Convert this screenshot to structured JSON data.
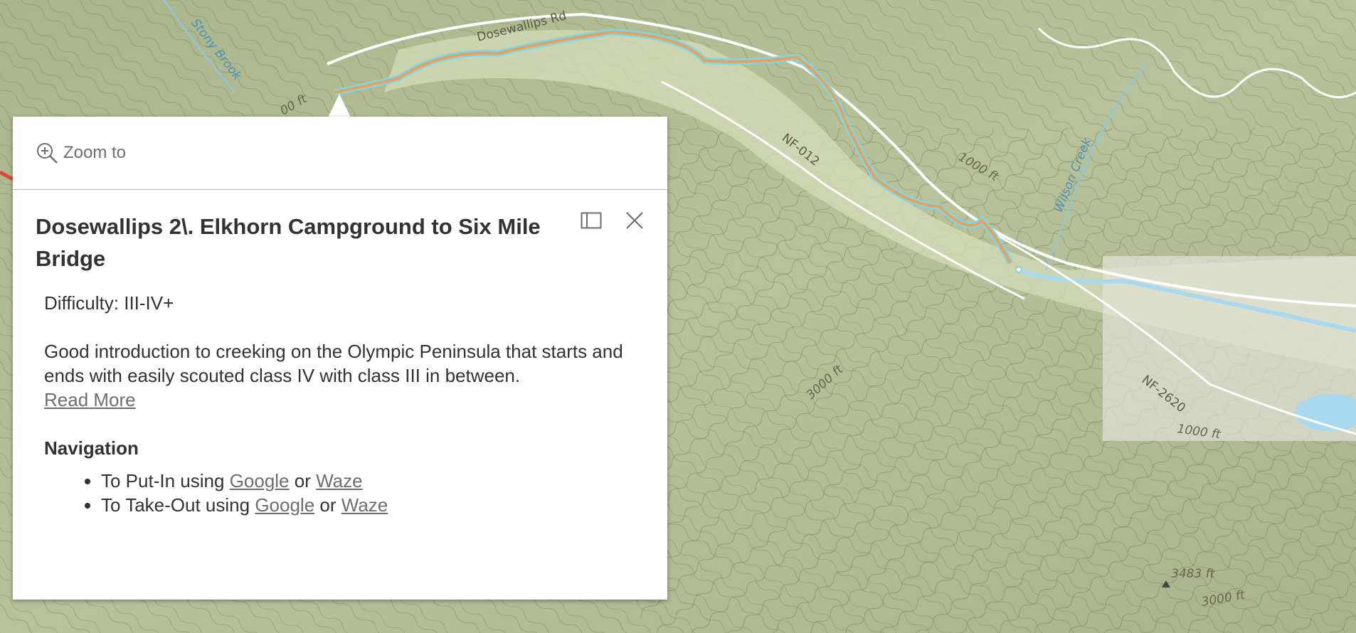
{
  "map": {
    "labels": {
      "road_dosewallips": "Dosewallips Rd",
      "stream_stony": "Stony Brook",
      "road_nf012": "NF-012",
      "contour_1000_a": "1000 ft",
      "stream_wilson": "Wilson Creek",
      "contour_3000_a": "3000 ft",
      "road_nf2620": "NF-2620",
      "contour_1000_b": "1000 ft",
      "peak_3483": "3483 ft",
      "contour_3000_b": "3000 ft",
      "contour_partial": "00 ft"
    },
    "colors": {
      "terrain": "#b9c39a",
      "river_highlight": "#7fd6e6",
      "route_line": "#e8a05a",
      "water": "#a9d9ef"
    }
  },
  "popup": {
    "zoom_label": "Zoom to",
    "zoom_icon": "zoom-in-icon",
    "title": "Dosewallips 2\\. Elkhorn Campground to Six Mile Bridge",
    "dock_icon": "dock-icon",
    "close_icon": "close-icon",
    "difficulty": "Difficulty: III-IV+",
    "description": "Good introduction to creeking on the Olympic Peninsula that starts and ends with easily scouted class IV with class III in between.",
    "read_more": "Read More",
    "navigation_heading": "Navigation",
    "nav_items": [
      {
        "prefix": "To Put-In using",
        "link1": "Google",
        "mid": "or",
        "link2": "Waze"
      },
      {
        "prefix": "To Take-Out using",
        "link1": "Google",
        "mid": "or",
        "link2": "Waze"
      }
    ]
  }
}
